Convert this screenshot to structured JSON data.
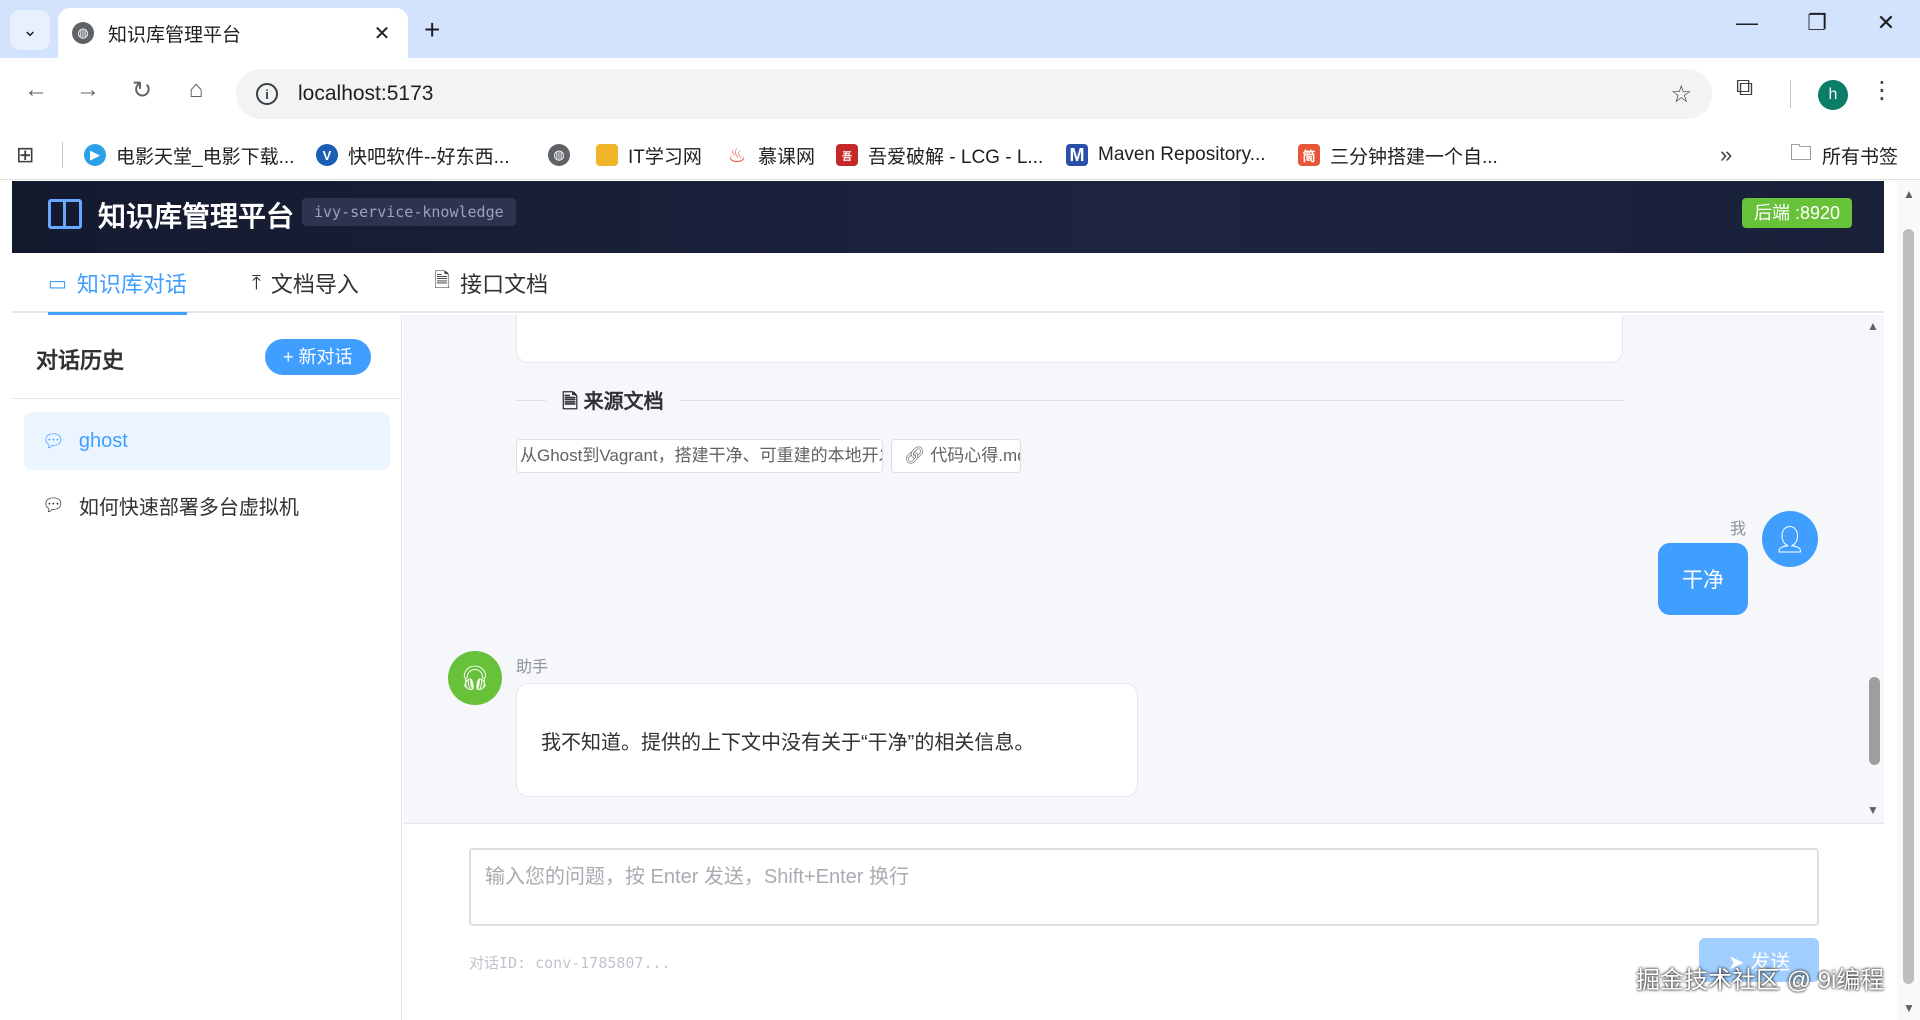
{
  "browser": {
    "tab_title": "知识库管理平台",
    "url": "localhost:5173",
    "profile_initial": "h",
    "bookmarks": [
      {
        "label": "电影天堂_电影下载...",
        "icon": "movie-heaven-icon",
        "color": "#2b9fe8"
      },
      {
        "label": "快吧软件--好东西...",
        "icon": "kuaiba-icon",
        "color": "#1a5fb4"
      },
      {
        "label": "",
        "icon": "globe-icon",
        "color": "#5f6368"
      },
      {
        "label": "IT学习网",
        "icon": "folder-icon",
        "color": "#f0b429"
      },
      {
        "label": "慕课网",
        "icon": "flame-icon",
        "color": "#e8463a"
      },
      {
        "label": "吾爱破解 - LCG - L...",
        "icon": "52pojie-icon",
        "color": "#c62828"
      },
      {
        "label": "Maven Repository...",
        "icon": "maven-icon",
        "color": "#2b4fa8"
      },
      {
        "label": "三分钟搭建一个自...",
        "icon": "jian-icon",
        "color": "#e8563a"
      }
    ],
    "all_bookmarks_label": "所有书签"
  },
  "app": {
    "title": "知识库管理平台",
    "service_tag": "ivy-service-knowledge",
    "backend_badge": "后端 :8920",
    "tabs": [
      {
        "label": "知识库对话",
        "icon": "chat-icon",
        "active": true
      },
      {
        "label": "文档导入",
        "icon": "upload-icon",
        "active": false
      },
      {
        "label": "接口文档",
        "icon": "document-icon",
        "active": false
      }
    ]
  },
  "sidebar": {
    "title": "对话历史",
    "new_chat_label": "+ 新对话",
    "conversations": [
      {
        "label": "ghost",
        "active": true
      },
      {
        "label": "如何快速部署多台虚拟机",
        "active": false
      }
    ]
  },
  "chat": {
    "sources_title": "来源文档",
    "sources": [
      "从Ghost到Vagrant，搭建干净、可重建的本地开发环境.md",
      "代码心得.md"
    ],
    "messages": [
      {
        "role": "user",
        "sender": "我",
        "text": "干净"
      },
      {
        "role": "assistant",
        "sender": "助手",
        "text": "我不知道。提供的上下文中没有关于“干净”的相关信息。"
      }
    ]
  },
  "input": {
    "placeholder": "输入您的问题，按 Enter 发送，Shift+Enter 换行",
    "value": "",
    "conversation_id": "对话ID: conv-1785807...",
    "send_label": "发送"
  },
  "watermark": "掘金技术社区 @ 9i编程",
  "colors": {
    "primary": "#409eff",
    "success": "#67c23a",
    "header_bg": "#1a2038"
  }
}
